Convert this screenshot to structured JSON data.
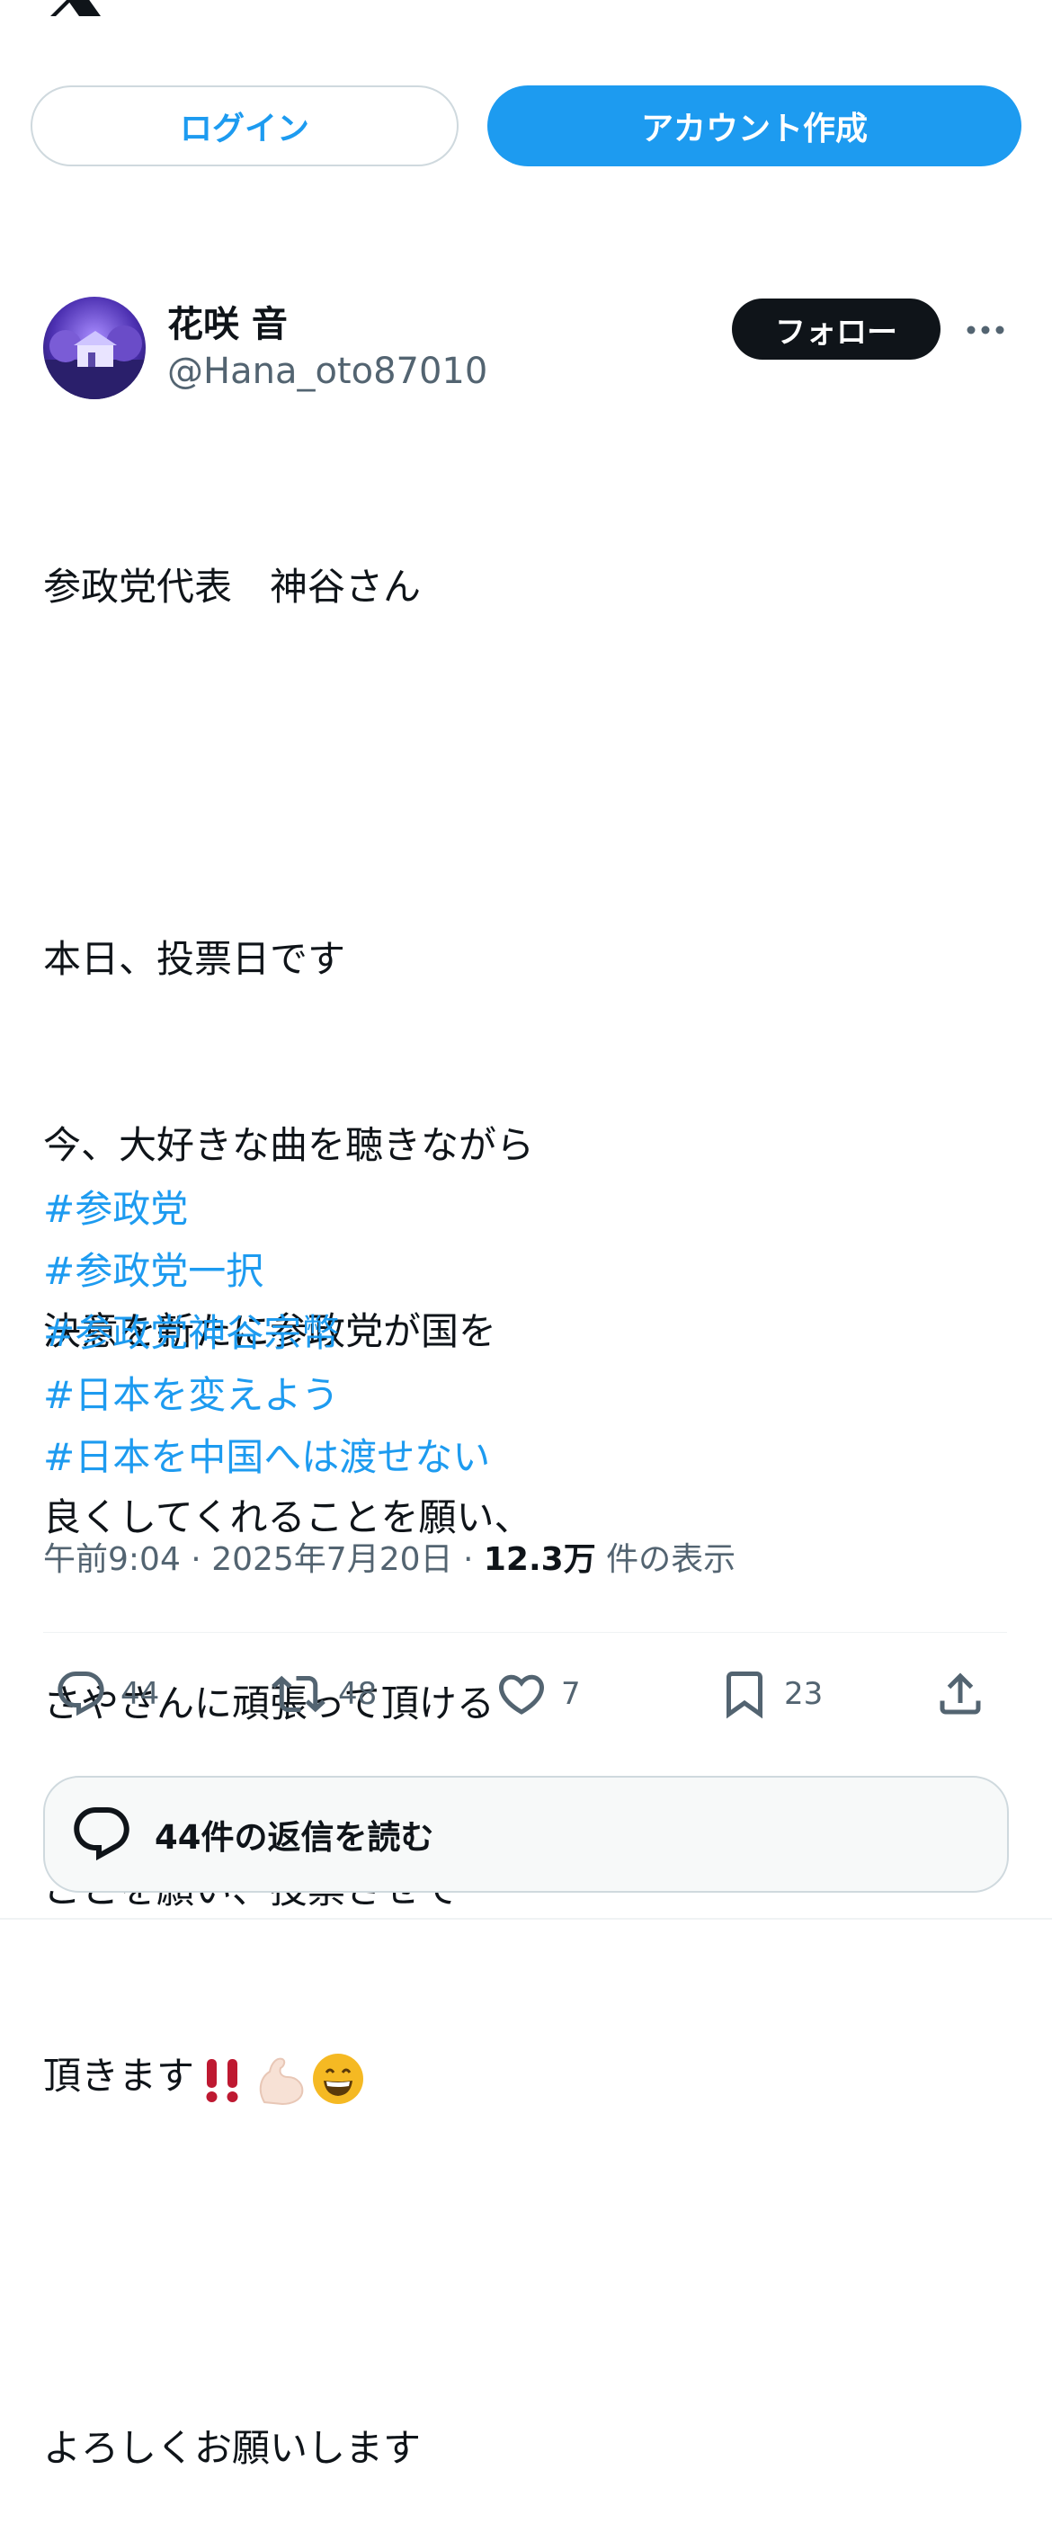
{
  "header": {
    "logo": "x-logo-icon"
  },
  "auth": {
    "login_label": "ログイン",
    "signup_label": "アカウント作成"
  },
  "post": {
    "author_name": "花咲 音",
    "author_handle": "@Hana_oto87010",
    "follow_label": "フォロー",
    "more_icon": "more-horizontal-icon",
    "lines": [
      "参政党代表　神谷さん",
      "",
      "本日、投票日です",
      "今、大好きな曲を聴きながら",
      "決意を新たに参政党が国を",
      "良くしてくれることを願い、",
      "さやさんに頑張って頂ける",
      "ことを願い、投票させて",
      "頂きます",
      "",
      "よろしくお願いします"
    ],
    "emojis": [
      "double-exclamation-icon",
      "flexed-biceps-icon",
      "grinning-face-icon"
    ],
    "hashtags": [
      "#参政党",
      "#参政党一択",
      "#参政党神谷宗幣",
      "#日本を変えよう",
      "#日本を中国へは渡せない"
    ],
    "meta": {
      "time": "午前9:04",
      "separator": " · ",
      "date": "2025年7月20日",
      "views_count": "12.3万",
      "views_label": " 件の表示"
    },
    "actions": {
      "replies": "44",
      "reposts": "48",
      "likes": "7",
      "bookmarks": "23"
    },
    "read_replies_label": "44件の返信を読む"
  },
  "colors": {
    "accent": "#1d9bf0",
    "text": "#0f1419",
    "muted": "#536471",
    "border": "#cfd9de"
  }
}
